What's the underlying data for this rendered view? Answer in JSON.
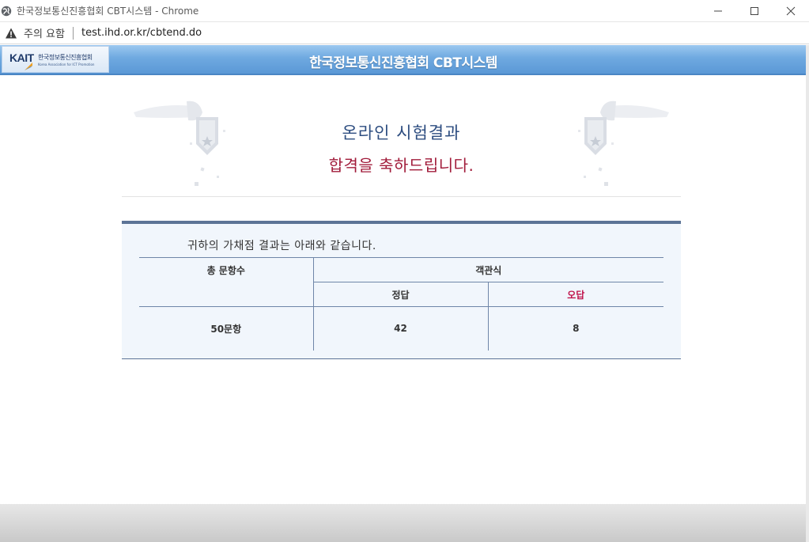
{
  "window": {
    "title": "한국정보통신진흥협회 CBT시스템 - Chrome"
  },
  "address_bar": {
    "security_text": "주의 요함",
    "url": "test.ihd.or.kr/cbtend.do"
  },
  "site": {
    "logo_kait": "KAIT",
    "logo_kr": "한국정보통신진흥협회",
    "logo_en": "Korea Association for ICT Promotion",
    "header_title": "한국정보통신진흥협회 CBT시스템"
  },
  "result": {
    "title": "온라인 시험결과",
    "pass_message": "합격을 축하드립니다.",
    "intro": "귀하의 가채점 결과는 아래와 같습니다.",
    "table": {
      "total_header": "총 문항수",
      "type_header": "객관식",
      "correct_header": "정답",
      "wrong_header": "오답",
      "total_value": "50문항",
      "correct_value": "42",
      "wrong_value": "8"
    }
  },
  "colors": {
    "header_blue": "#6ea9e0",
    "title_blue": "#2d4d80",
    "pass_red": "#a11b3a",
    "wrong_red": "#c0144c",
    "box_bg": "#f1f6fc"
  }
}
